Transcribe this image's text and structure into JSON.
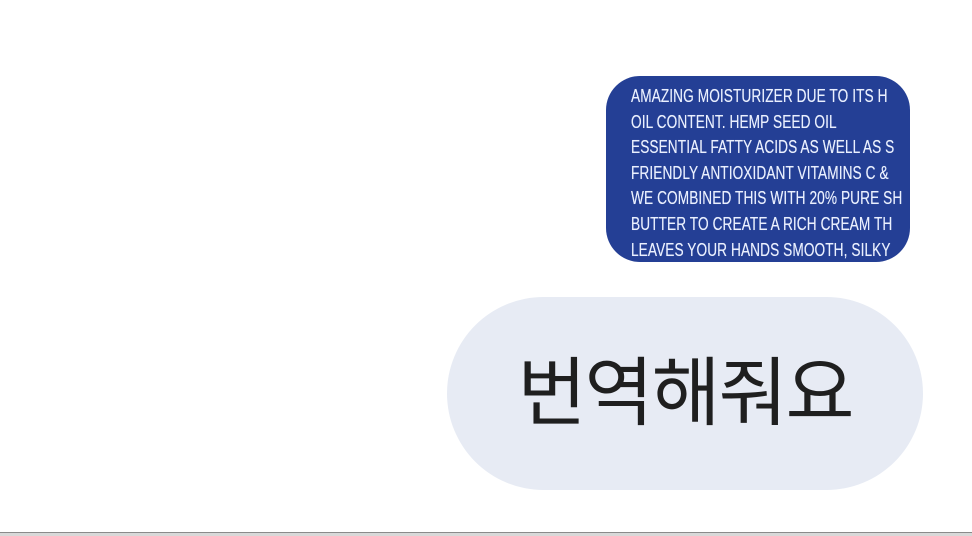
{
  "chat": {
    "messages": [
      {
        "type": "image",
        "image_text_lines": [
          "AMAZING MOISTURIZER DUE TO ITS H",
          "OIL  CONTENT.  HEMP  SEED  OIL",
          "ESSENTIAL FATTY ACIDS AS WELL AS S",
          "FRIENDLY  ANTIOXIDANT  VITAMINS  C  &",
          "WE COMBINED THIS WITH 20% PURE SH",
          "BUTTER TO CREATE A RICH CREAM TH",
          "LEAVES YOUR HANDS SMOOTH, SILKY"
        ],
        "background_color": "#243f95"
      },
      {
        "type": "text",
        "text": "번역해줘요",
        "bubble_color": "#e7ebf4"
      }
    ]
  }
}
